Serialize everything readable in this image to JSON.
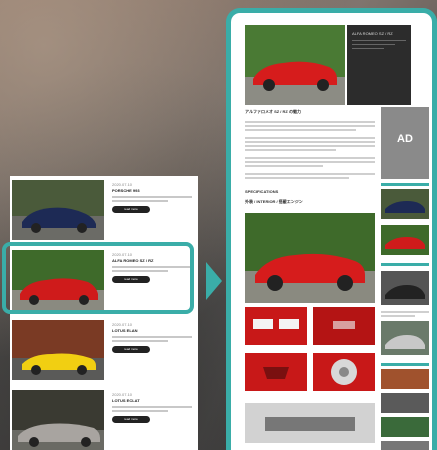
{
  "left_list": {
    "items": [
      {
        "date": "2020.07.10",
        "title": "PORSCHE 993",
        "button": "read more"
      },
      {
        "date": "2020.07.10",
        "title": "ALFA ROMEO SZ / RZ",
        "button": "read more"
      },
      {
        "date": "2020.07.10",
        "title": "LOTUS ELAN",
        "button": "read more"
      },
      {
        "date": "2020.07.10",
        "title": "LOTUS ECLAT",
        "button": "read more"
      }
    ]
  },
  "article": {
    "hero_title": "ALFA ROMEO SZ / RZ",
    "title": "アルファロメオ SZ / RZ の魅力",
    "sub_heading_1": "SPECIFICATIONS",
    "sub_heading_2": "外装 / INTERIOR / 搭載エンジン"
  },
  "ad": {
    "label": "AD"
  },
  "colors": {
    "accent": "#3aada8",
    "ad_gray": "#8a8a8a",
    "hero_dark": "#2c2c2c"
  }
}
